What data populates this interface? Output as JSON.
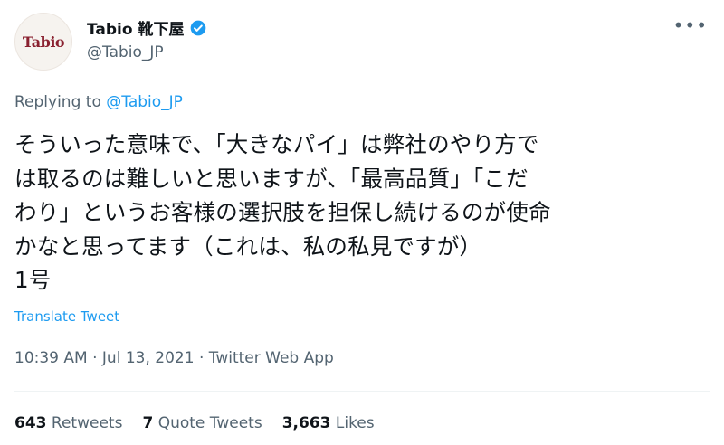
{
  "author": {
    "avatar_text": "Tabio",
    "display_name": "Tabio 靴下屋",
    "handle": "@Tabio_JP",
    "verified_color": "#1d9bf0"
  },
  "reply": {
    "prefix": "Replying to ",
    "mention": "@Tabio_JP"
  },
  "tweet": {
    "text": "そういった意味で、「大きなパイ」は弊社のやり方で\nは取るのは難しいと思いますが、「最高品質」「こだ\nわり」というお客様の選択肢を担保し続けるのが使命\nかなと思ってます（これは、私の私見ですが）\n1号",
    "translate_label": "Translate Tweet",
    "time": "10:39 AM",
    "separator1": " · ",
    "date": "Jul 13, 2021",
    "separator2": " · ",
    "source": "Twitter Web App"
  },
  "stats": {
    "retweets_count": "643",
    "retweets_label": "Retweets",
    "quotes_count": "7",
    "quotes_label": "Quote Tweets",
    "likes_count": "3,663",
    "likes_label": "Likes"
  },
  "icons": {
    "more": "more-icon",
    "verified": "verified-badge-icon"
  }
}
